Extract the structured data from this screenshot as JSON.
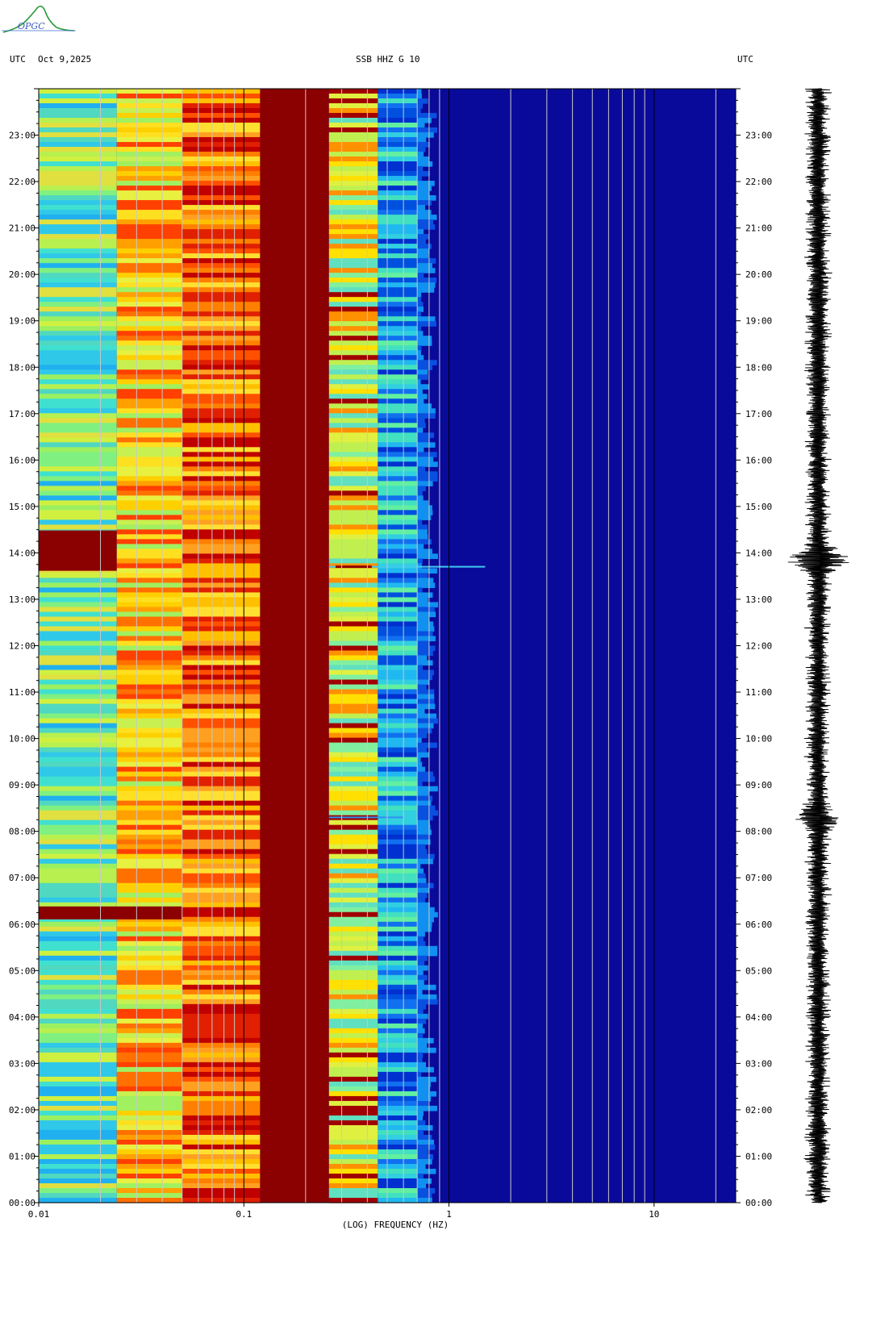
{
  "logo": {
    "text": "OPGC"
  },
  "header": {
    "left_timezone": "UTC",
    "date": "Oct 9,2025",
    "station": "SSB HHZ G 10",
    "right_timezone": "UTC"
  },
  "colors": {
    "background_low": "#0a0a9a",
    "high_energy": "#8b0000",
    "gridline": "#c8c8c8"
  },
  "chart_data": {
    "type": "heatmap",
    "title": "SSB HHZ G 10",
    "xlabel": "(LOG) FREQUENCY (HZ)",
    "ylabel": "UTC",
    "x_scale": "log",
    "xlim": [
      0.01,
      25
    ],
    "ylim": [
      "00:00",
      "24:00"
    ],
    "x_tick_labels": [
      "0.01",
      "0.1",
      "1",
      "10"
    ],
    "x_tick_values": [
      0.01,
      0.1,
      1,
      10
    ],
    "y_tick_labels": [
      "00:00",
      "01:00",
      "02:00",
      "03:00",
      "04:00",
      "05:00",
      "06:00",
      "07:00",
      "08:00",
      "09:00",
      "10:00",
      "11:00",
      "12:00",
      "13:00",
      "14:00",
      "15:00",
      "16:00",
      "17:00",
      "18:00",
      "19:00",
      "20:00",
      "21:00",
      "22:00",
      "23:00"
    ],
    "y_tick_hours": [
      0,
      1,
      2,
      3,
      4,
      5,
      6,
      7,
      8,
      9,
      10,
      11,
      12,
      13,
      14,
      15,
      16,
      17,
      18,
      19,
      20,
      21,
      22,
      23
    ],
    "spectral_bands": [
      {
        "f_min": 0.01,
        "f_max": 0.024,
        "level": "green-cyan"
      },
      {
        "f_min": 0.024,
        "f_max": 0.05,
        "level": "yellow-orange"
      },
      {
        "f_min": 0.05,
        "f_max": 0.12,
        "level": "orange-red"
      },
      {
        "f_min": 0.12,
        "f_max": 0.26,
        "level": "dark-red"
      },
      {
        "f_min": 0.26,
        "f_max": 0.45,
        "level": "yellow-green"
      },
      {
        "f_min": 0.45,
        "f_max": 0.7,
        "level": "cyan-blue"
      },
      {
        "f_min": 0.7,
        "f_max": 25,
        "level": "dark-blue"
      }
    ],
    "events": [
      {
        "time_hours": 13.7,
        "f_max": 1.5,
        "description": "broadband line"
      },
      {
        "time_hours": 14.1,
        "f_max": 0.024,
        "description": "low-frequency burst"
      },
      {
        "time_hours": 6.0,
        "f_max": 0.05,
        "description": "low-frequency burst"
      },
      {
        "time_hours": 8.3,
        "f_max": 0.6,
        "description": "line"
      }
    ],
    "waveform_event_hours": [
      13.85,
      8.3
    ]
  }
}
